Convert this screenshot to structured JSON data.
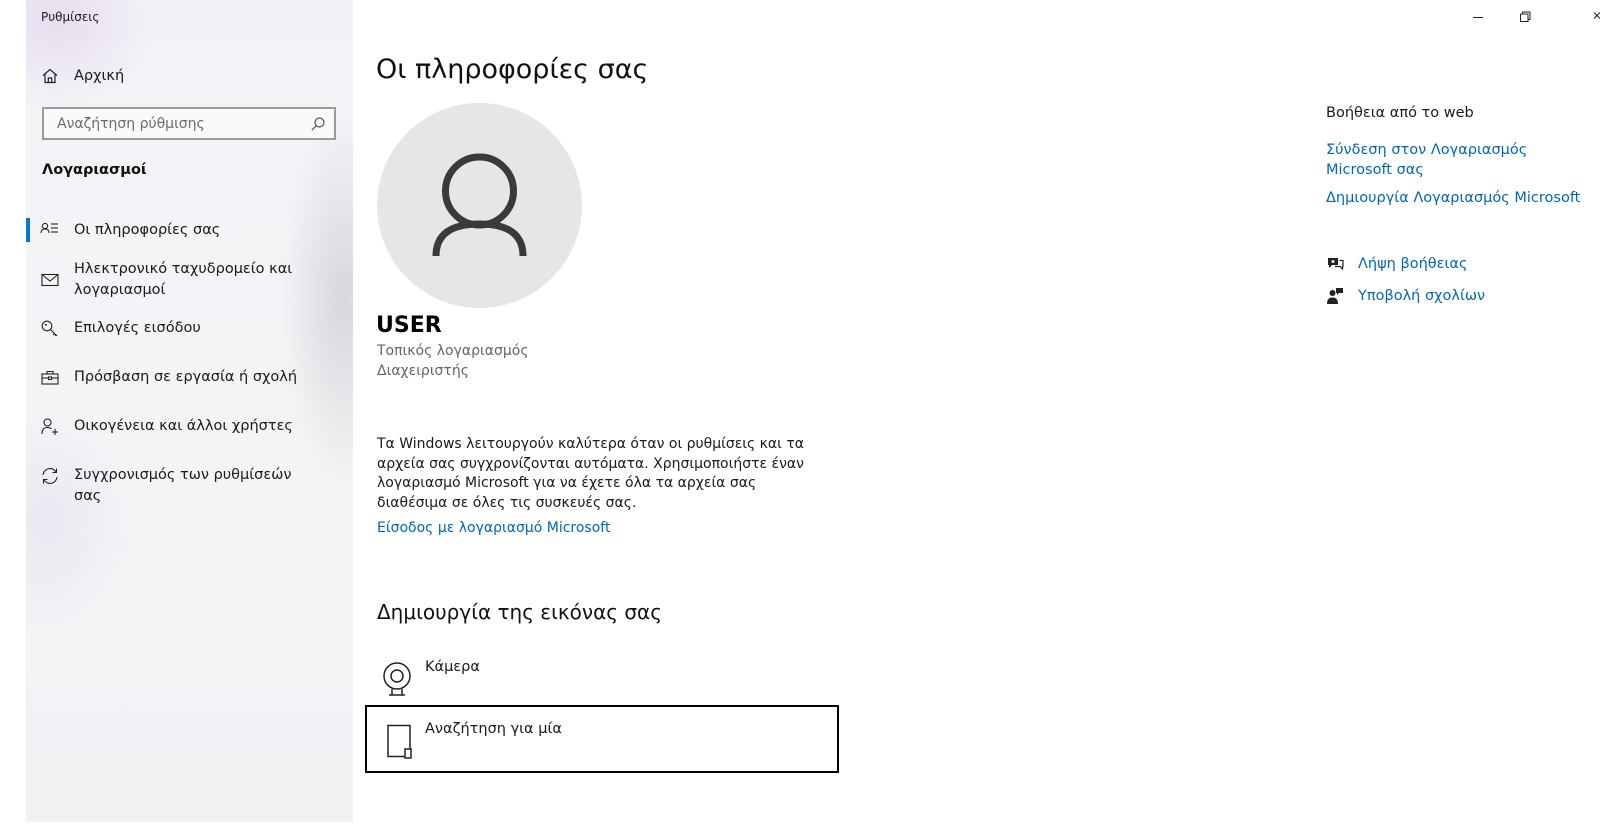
{
  "window": {
    "title": "Ρυθμίσεις",
    "controls": [
      "minimize",
      "restore",
      "close"
    ]
  },
  "sidebar": {
    "home_label": "Αρχική",
    "search_placeholder": "Αναζήτηση ρύθμισης",
    "section_title": "Λογαριασμοί",
    "items": [
      {
        "label": "Οι πληροφορίες σας",
        "icon": "user-info-icon",
        "selected": true
      },
      {
        "label": "Ηλεκτρονικό ταχυδρομείο και λογαριασμοί",
        "icon": "mail-icon",
        "selected": false
      },
      {
        "label": "Επιλογές εισόδου",
        "icon": "key-icon",
        "selected": false
      },
      {
        "label": "Πρόσβαση σε εργασία ή σχολή",
        "icon": "briefcase-icon",
        "selected": false
      },
      {
        "label": "Οικογένεια και άλλοι χρήστες",
        "icon": "add-person-icon",
        "selected": false
      },
      {
        "label": "Συγχρονισμός των ρυθμίσεών σας",
        "icon": "sync-icon",
        "selected": false
      }
    ]
  },
  "main": {
    "title": "Οι πληροφορίες σας",
    "user_name": "USER",
    "account_type": "Τοπικός λογαριασμός",
    "role": "Διαχειριστής",
    "description": "Τα Windows λειτουργούν καλύτερα όταν οι ρυθμίσεις και τα αρχεία σας συγχρονίζονται αυτόματα. Χρησιμοποιήστε έναν λογαριασμό Microsoft για να έχετε όλα τα αρχεία σας διαθέσιμα σε όλες τις συσκευές σας.",
    "ms_signin_link": "Είσοδος με λογαριασμό Microsoft",
    "create_picture_title": "Δημιουργία της εικόνας σας",
    "camera_label": "Κάμερα",
    "browse_label": "Αναζήτηση για μία"
  },
  "help": {
    "title": "Βοήθεια από το web",
    "links": [
      "Σύνδεση στον Λογαριασμός Microsoft σας",
      "Δημιουργία Λογαριασμός Microsoft"
    ],
    "get_help": "Λήψη βοήθειας",
    "feedback": "Υποβολή σχολίων"
  },
  "colors": {
    "accent": "#0078d4",
    "link": "#0067b8",
    "avatar_bg": "#e6e6e6",
    "avatar_icon": "#3a3a3a"
  }
}
